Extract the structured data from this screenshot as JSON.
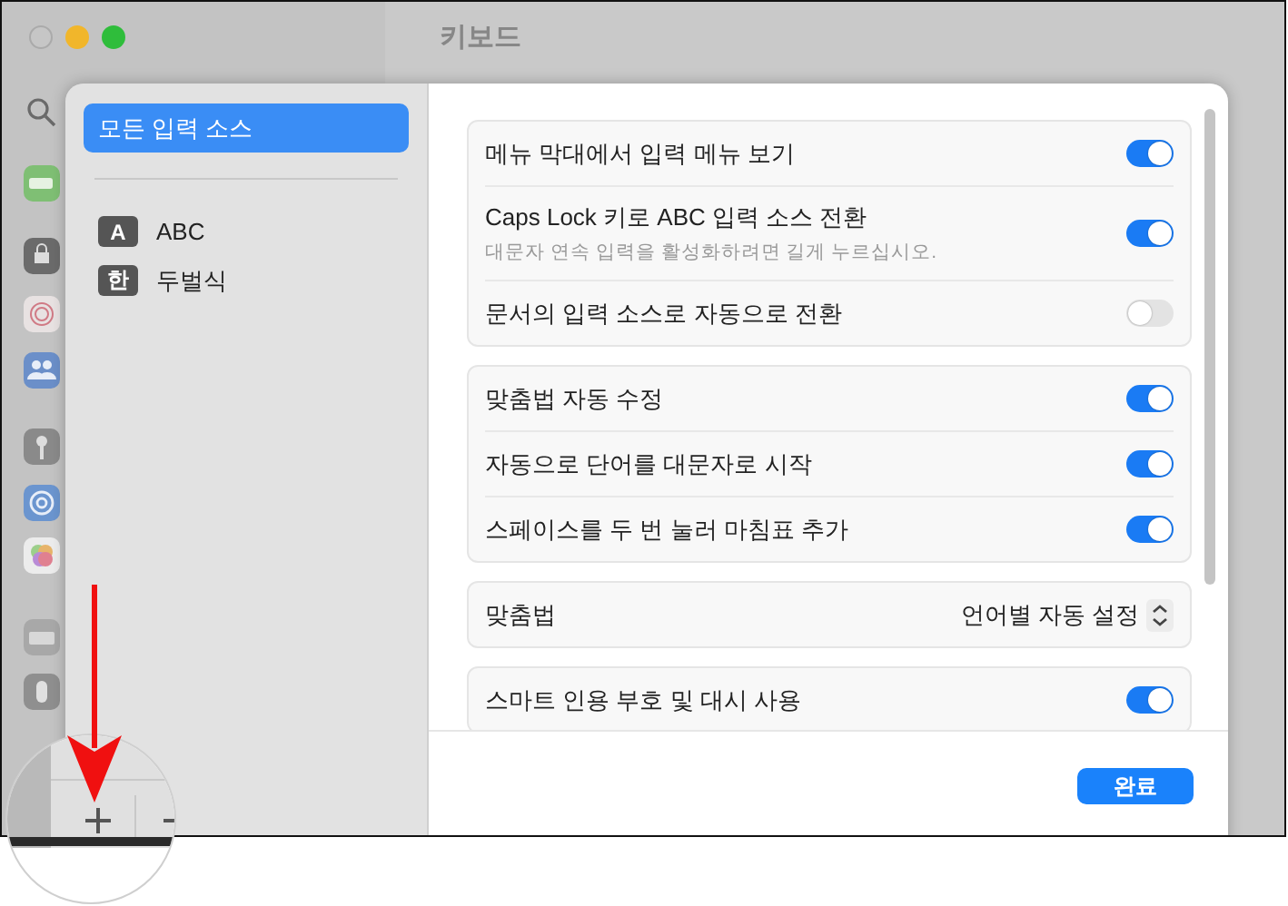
{
  "window": {
    "title": "키보드"
  },
  "sheet": {
    "sources": [
      {
        "label": "모든 입력 소스",
        "selected": true
      },
      {
        "badge": "A",
        "label": "ABC",
        "selected": false
      },
      {
        "badge": "한",
        "label": "두벌식",
        "selected": false
      }
    ],
    "groups": [
      {
        "rows": [
          {
            "kind": "toggle",
            "label": "메뉴 막대에서 입력 메뉴 보기",
            "on": true
          },
          {
            "kind": "toggle",
            "label": "Caps Lock 키로 ABC 입력 소스 전환",
            "description": "대문자 연속 입력을 활성화하려면 길게 누르십시오.",
            "on": true
          },
          {
            "kind": "toggle",
            "label": "문서의 입력 소스로 자동으로 전환",
            "on": false
          }
        ]
      },
      {
        "rows": [
          {
            "kind": "toggle",
            "label": "맞춤법 자동 수정",
            "on": true
          },
          {
            "kind": "toggle",
            "label": "자동으로 단어를 대문자로 시작",
            "on": true
          },
          {
            "kind": "toggle",
            "label": "스페이스를 두 번 눌러 마침표 추가",
            "on": true
          }
        ]
      },
      {
        "rows": [
          {
            "kind": "popup",
            "label": "맞춤법",
            "value": "언어별 자동 설정"
          }
        ]
      },
      {
        "rows": [
          {
            "kind": "toggle",
            "label": "스마트 인용 부호 및 대시 사용",
            "on": true
          }
        ]
      }
    ],
    "done_button": "완료"
  }
}
